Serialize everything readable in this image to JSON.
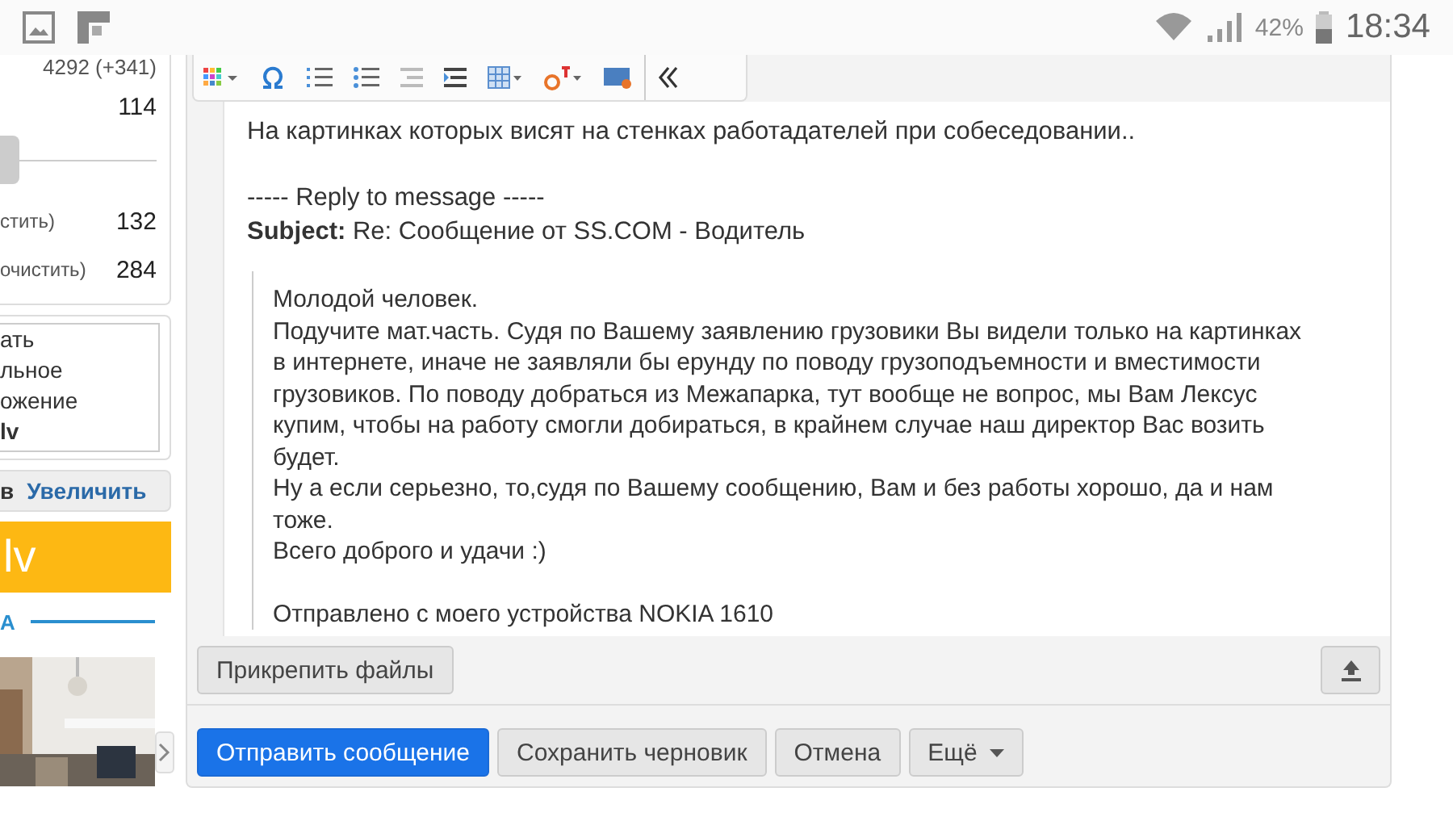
{
  "status_bar": {
    "battery": "42%",
    "time": "18:34"
  },
  "sidebar": {
    "totals": [
      "4292 (+341)",
      "114"
    ],
    "counts": [
      {
        "label": "стить)",
        "value": "132"
      },
      {
        "label": "очистить)",
        "value": "284"
      }
    ],
    "slider": {
      "level": 0.0
    },
    "list": [
      {
        "text": "ать",
        "bold": false
      },
      {
        "text": "льное",
        "bold": false
      },
      {
        "text": "ожение",
        "bold": false
      },
      {
        "text": "lv",
        "bold": true
      }
    ],
    "zoom_prefix": "в",
    "zoom_link": "Увеличить",
    "banner": "lv",
    "section": "А"
  },
  "editor": {
    "message": "На картинках которых висят на стенках работадателей при собеседовании..",
    "reply_header": "----- Reply to message -----",
    "subject": "**Subject:** Re: Сообщение от SS.COM - Водитель",
    "quote": [
      "Молодой человек.",
      "Подучите мат.часть. Судя по Вашему заявлению грузовики Вы видели только на картинках в интернете, иначе не заявляли бы ерунду по поводу грузоподъемности и вместимости грузовиков. По поводу добраться из Межапарка, тут вообще не вопрос, мы Вам Лексус купим, чтобы на работу смогли добираться, в крайнем случае наш директор Вас возить будет.",
      "Ну а если серьезно, то,судя по Вашему сообщению, Вам и без работы хорошо, да и нам тоже.",
      "Всего доброго и удачи :)"
    ],
    "signature": "Отправлено с моего устройства NOKIA 1610",
    "attach": "Прикрепить файлы"
  },
  "buttons": [
    {
      "label": "Отправить сообщение",
      "kind": "primary"
    },
    {
      "label": "Сохранить черновик",
      "kind": "default"
    },
    {
      "label": "Отмена",
      "kind": "default"
    },
    {
      "label": "Ещё",
      "kind": "dropdown"
    }
  ]
}
